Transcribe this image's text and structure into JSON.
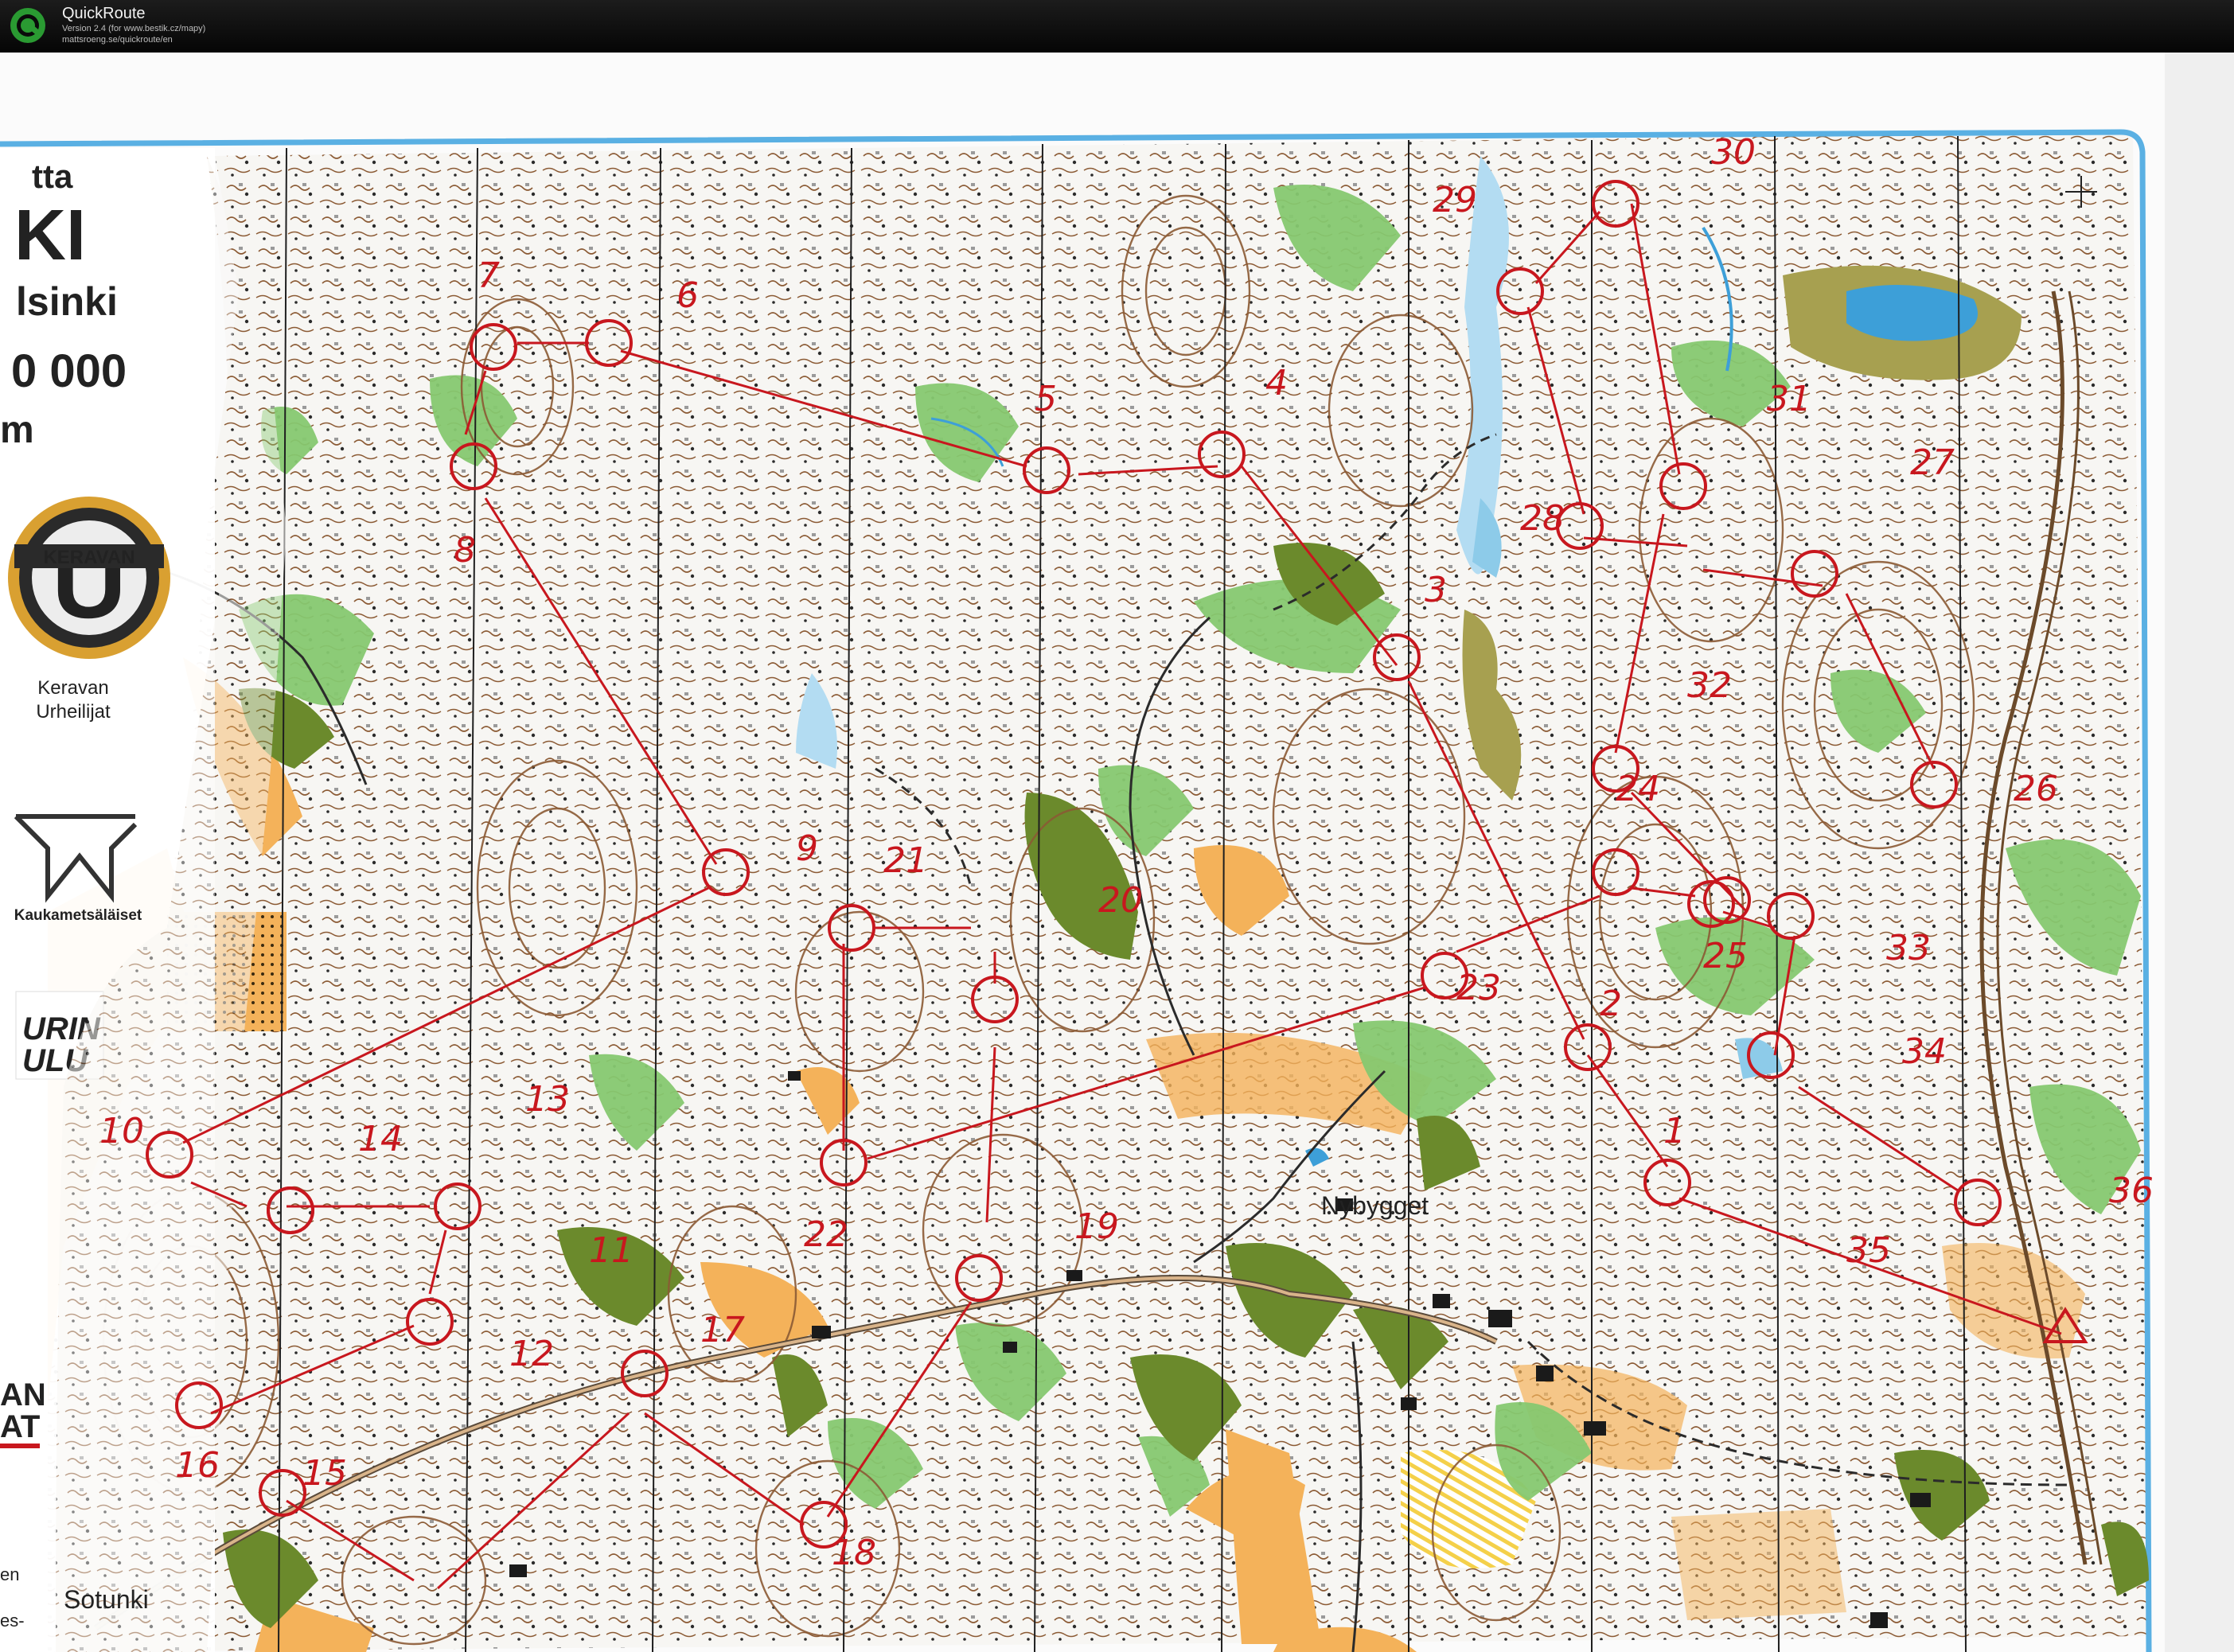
{
  "window": {
    "app_name": "QuickRoute",
    "version_line": "Version 2.4  (for www.bestik.cz/mapy)",
    "url_line": "mattsroeng.se/quickroute/en",
    "app_icon": "quickroute-q-icon"
  },
  "map": {
    "title_fragments": [
      "tta",
      "KI",
      "lsinki",
      "0 000",
      "m"
    ],
    "club_logo_letter": "U",
    "club_logo_text": "KERAVAN",
    "club_name_line1": "Keravan",
    "club_name_line2": "Urheilijat",
    "sponsor_name": "Kaukametsäläiset",
    "sponsor2_text_a": "URIN",
    "sponsor2_text_b": "ULU",
    "sponsor3_text_a": "AN",
    "sponsor3_text_b": "AT",
    "place_names": [
      "Nybygget",
      "Sotunki"
    ],
    "left_edge_fragments": [
      "en",
      "es-"
    ],
    "control_numbers": [
      "1",
      "2",
      "3",
      "4",
      "5",
      "6",
      "7",
      "8",
      "9",
      "10",
      "11",
      "12",
      "13",
      "14",
      "15",
      "16",
      "17",
      "18",
      "19",
      "20",
      "21",
      "22",
      "23",
      "24",
      "25",
      "26",
      "27",
      "28",
      "29",
      "30",
      "31",
      "32",
      "33",
      "34",
      "35",
      "36"
    ],
    "colors": {
      "control_red": "#c8171e",
      "open_land": "#f4b25a",
      "green_vegetation": "#7ac25e",
      "dark_green": "#6b8a2c",
      "water": "#3d9fd8",
      "contour_brown": "#8b5a34",
      "map_border_blue": "#5ab0e3"
    }
  }
}
